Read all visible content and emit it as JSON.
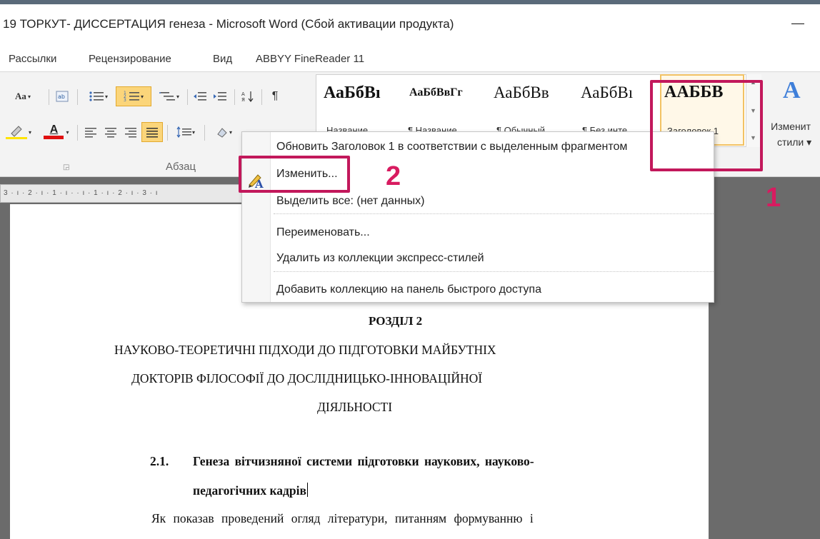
{
  "window": {
    "title": "19 ТОРКУТ- ДИССЕРТАЦИЯ генеза - Microsoft Word (Сбой активации продукта)",
    "minimize_glyph": "—"
  },
  "tabs": [
    "Рассылки",
    "Рецензирование",
    "Вид",
    "ABBYY FineReader 11"
  ],
  "ribbon": {
    "paragraph_group_label": "Абзац",
    "font_size_button": "Aa",
    "font_color_letter": "A",
    "sort_glyph": "↓",
    "pilcrow_glyph": "¶",
    "styles": [
      {
        "sample": "АаБбВı",
        "name": "Название",
        "bold": true
      },
      {
        "sample": "АаБбВвГг",
        "name": "¶ Название",
        "bold": true
      },
      {
        "sample": "АаБбВв",
        "name": "¶ Обычный",
        "bold": false
      },
      {
        "sample": "АаБбВı",
        "name": "¶ Без инте...",
        "bold": false
      },
      {
        "sample": "ААББВ",
        "name": "Заголовок 1",
        "bold": true,
        "selected": true
      }
    ],
    "change_styles": {
      "icon": "A",
      "line1": "Изменит",
      "line2": "стили ▾"
    },
    "colors": {
      "highlight": "#ffe400",
      "font_color": "#e01010",
      "selected_style_border": "#f2c264"
    }
  },
  "ruler": {
    "text": "3 · ı · 2 · ı · 1 · ı ·   · ı · 1 · ı · 2 · ı · 3 · ı"
  },
  "context_menu": {
    "items": [
      {
        "label": "Обновить Заголовок 1 в соответствии с выделенным фрагментом"
      },
      {
        "label": "Изменить...",
        "icon": "modify-style-icon"
      },
      {
        "label": "Выделить все: (нет данных)"
      },
      {
        "label": "Переименовать..."
      },
      {
        "label": "Удалить из коллекции экспресс-стилей"
      },
      {
        "label": "Добавить коллекцию на панель быстрого доступа"
      }
    ]
  },
  "annotations": {
    "box1_label": "1",
    "box2_label": "2",
    "color": "#c2185b"
  },
  "document": {
    "section": "РОЗДІЛ 2",
    "heading_line1": "НАУКОВО-ТЕОРЕТИЧНІ ПІДХОДИ ДО ПІДГОТОВКИ МАЙБУТНІХ",
    "heading_line2": "ДОКТОРІВ ФІЛОСОФІЇ ДО ДОСЛІДНИЦЬКО-ІННОВАЦІЙНОЇ",
    "heading_line3": "ДІЯЛЬНОСТІ",
    "subsection_number": "2.1.",
    "subsection_line1": "Генеза вітчизняної системи підготовки наукових, науково-",
    "subsection_line2": "педагогічних кадрів",
    "body_line1": "Як показав проведений огляд літератури, питанням формуванню і"
  }
}
